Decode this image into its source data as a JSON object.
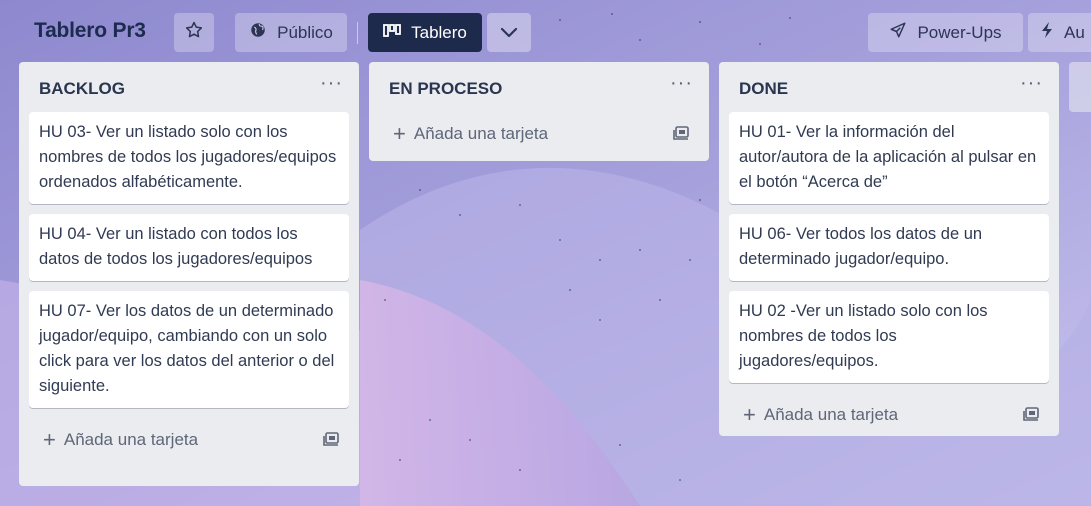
{
  "header": {
    "board_title": "Tablero Pr3",
    "visibility_label": "Público",
    "view_label": "Tablero",
    "powerups_label": "Power-Ups",
    "automation_label": "Au"
  },
  "lists": [
    {
      "title": "BACKLOG",
      "menu": "···",
      "cards": [
        "HU 03- Ver un listado solo con los nombres de todos los jugadores/equipos ordenados alfabéticamente.",
        "HU 04- Ver un listado con todos los datos de todos los jugadores/equipos",
        "HU 07- Ver los datos de un determinado jugador/equipo, cambiando con un solo click para ver los datos del anterior o del siguiente."
      ],
      "add_label": "Añada una tarjeta"
    },
    {
      "title": "EN PROCESO",
      "menu": "···",
      "cards": [],
      "add_label": "Añada una tarjeta"
    },
    {
      "title": "DONE",
      "menu": "···",
      "cards": [
        "HU 01- Ver la información del autor/autora de la aplicación al pulsar en el botón “Acerca de”",
        "HU 06- Ver todos los datos de un determinado jugador/equipo.",
        "HU 02 -Ver un listado solo con los nombres de todos los jugadores/equipos."
      ],
      "add_label": "Añada una tarjeta"
    }
  ],
  "icons": {
    "star": "star-icon",
    "visibility": "globe-icon",
    "view": "board-icon",
    "chevron": "chevron-down-icon",
    "powerups": "rocket-icon",
    "automation": "lightning-icon",
    "list_menu": "ellipsis-icon",
    "template": "card-template-icon"
  },
  "colors": {
    "header_active_button": "#1e2a4b",
    "list_background": "#ebecf0",
    "card_background": "#ffffff",
    "title_text": "#1d2b4f"
  }
}
